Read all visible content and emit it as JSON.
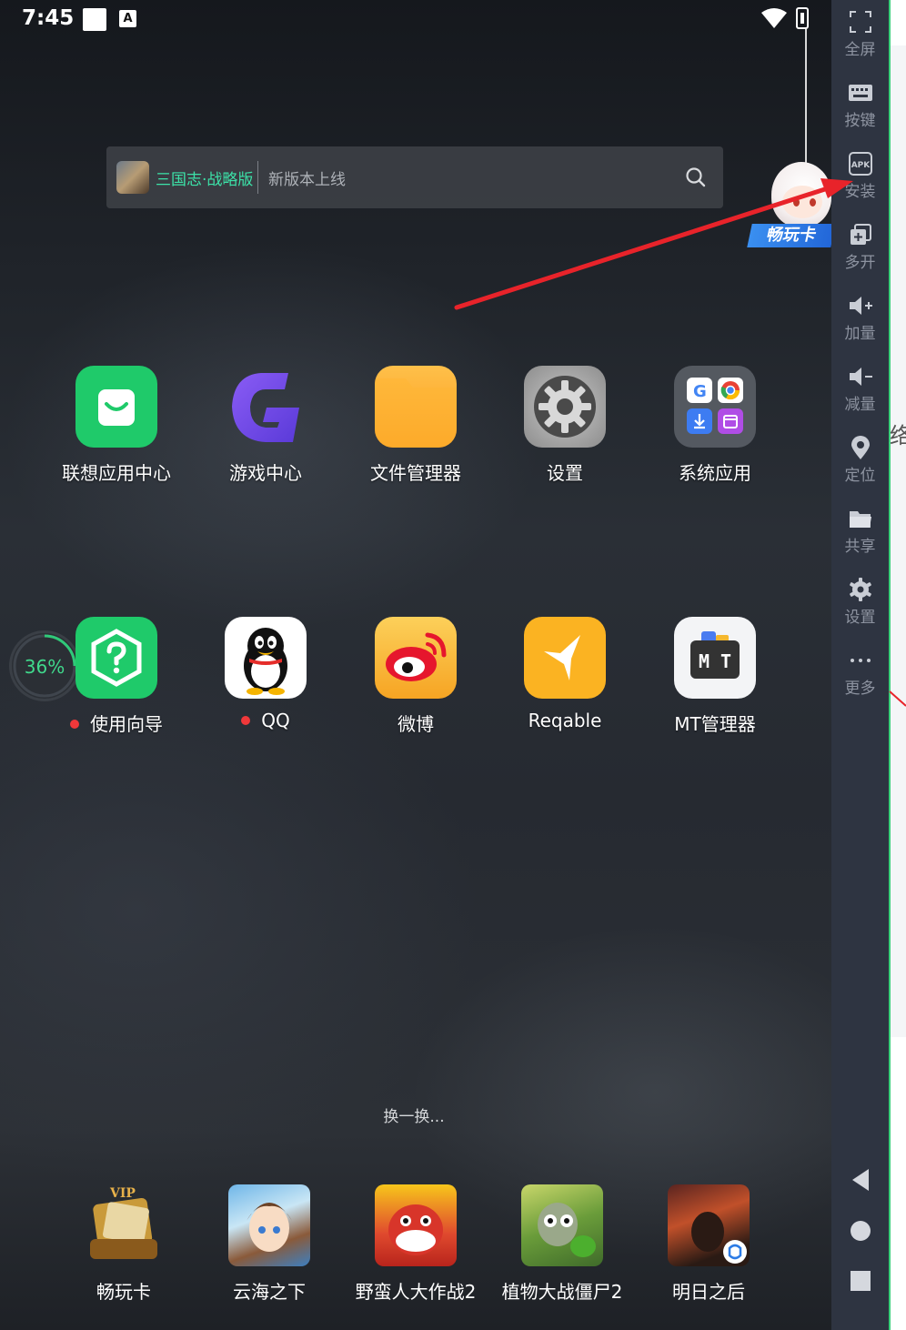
{
  "status_bar": {
    "time": "7:45",
    "notif_letter": "A"
  },
  "search_bar": {
    "game_name": "三国志·战略版",
    "hint": "新版本上线"
  },
  "mascot": {
    "label": "畅玩卡"
  },
  "apps_row1": [
    {
      "label": "联想应用中心"
    },
    {
      "label": "游戏中心"
    },
    {
      "label": "文件管理器"
    },
    {
      "label": "设置"
    },
    {
      "label": "系统应用"
    }
  ],
  "apps_row2": [
    {
      "label": "使用向导"
    },
    {
      "label": "QQ"
    },
    {
      "label": "微博"
    },
    {
      "label": "Reqable"
    },
    {
      "label": "MT管理器"
    }
  ],
  "memory_widget": {
    "percent": "36%"
  },
  "mt_icon_text": "M T",
  "shuffle": "换一换...",
  "dock_games": [
    {
      "label": "畅玩卡",
      "badge": "VIP"
    },
    {
      "label": "云海之下"
    },
    {
      "label": "野蛮人大作战2"
    },
    {
      "label": "植物大战僵尸2"
    },
    {
      "label": "明日之后"
    }
  ],
  "toolbar": [
    {
      "label": "全屏",
      "icon": "fullscreen-icon"
    },
    {
      "label": "按键",
      "icon": "keyboard-icon"
    },
    {
      "label": "安装",
      "icon": "apk-install-icon",
      "icon_text": "APK"
    },
    {
      "label": "多开",
      "icon": "multi-instance-icon"
    },
    {
      "label": "加量",
      "icon": "volume-up-icon"
    },
    {
      "label": "减量",
      "icon": "volume-down-icon"
    },
    {
      "label": "定位",
      "icon": "location-icon"
    },
    {
      "label": "共享",
      "icon": "folder-icon"
    },
    {
      "label": "设置",
      "icon": "gear-icon"
    },
    {
      "label": "更多",
      "icon": "more-icon"
    }
  ],
  "nav_buttons": [
    "back-icon",
    "home-icon",
    "recents-icon"
  ],
  "sliver_text": "络",
  "colors": {
    "toolbar_bg": "#2e3441",
    "toolbar_text": "#8d93a0",
    "accent_green": "#3ce2a8",
    "arrow_red": "#e8232a"
  }
}
